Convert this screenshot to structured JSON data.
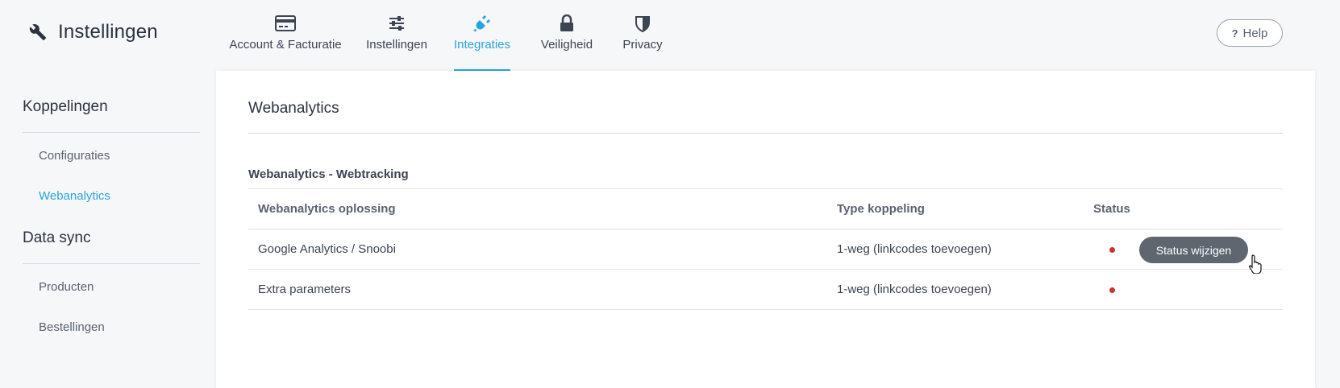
{
  "header": {
    "title": "Instellingen",
    "icon": "wrench-icon",
    "help_label": "Help",
    "help_icon": "question-icon"
  },
  "nav": {
    "accent_color": "#2aa4dc",
    "items": [
      {
        "label": "Account & Facturatie",
        "icon": "credit-card-icon",
        "active": false
      },
      {
        "label": "Instellingen",
        "icon": "sliders-icon",
        "active": false
      },
      {
        "label": "Integraties",
        "icon": "plug-icon",
        "active": true
      },
      {
        "label": "Veiligheid",
        "icon": "lock-icon",
        "active": false
      },
      {
        "label": "Privacy",
        "icon": "shield-icon",
        "active": false
      }
    ]
  },
  "sidebar": {
    "groups": [
      {
        "heading": "Koppelingen",
        "items": [
          {
            "label": "Configuraties",
            "active": false
          },
          {
            "label": "Webanalytics",
            "active": true
          }
        ]
      },
      {
        "heading": "Data sync",
        "items": [
          {
            "label": "Producten",
            "active": false
          },
          {
            "label": "Bestellingen",
            "active": false
          }
        ]
      }
    ]
  },
  "main": {
    "title": "Webanalytics",
    "section_title": "Webanalytics - Webtracking",
    "table": {
      "columns": [
        "Webanalytics oplossing",
        "Type koppeling",
        "Status"
      ],
      "rows": [
        {
          "name": "Google Analytics / Snoobi",
          "type": "1-weg (linkcodes toevoegen)",
          "status_color": "#d0312d",
          "action_label": "Status wijzigen"
        },
        {
          "name": "Extra parameters",
          "type": "1-weg (linkcodes toevoegen)",
          "status_color": "#d0312d"
        }
      ]
    }
  }
}
